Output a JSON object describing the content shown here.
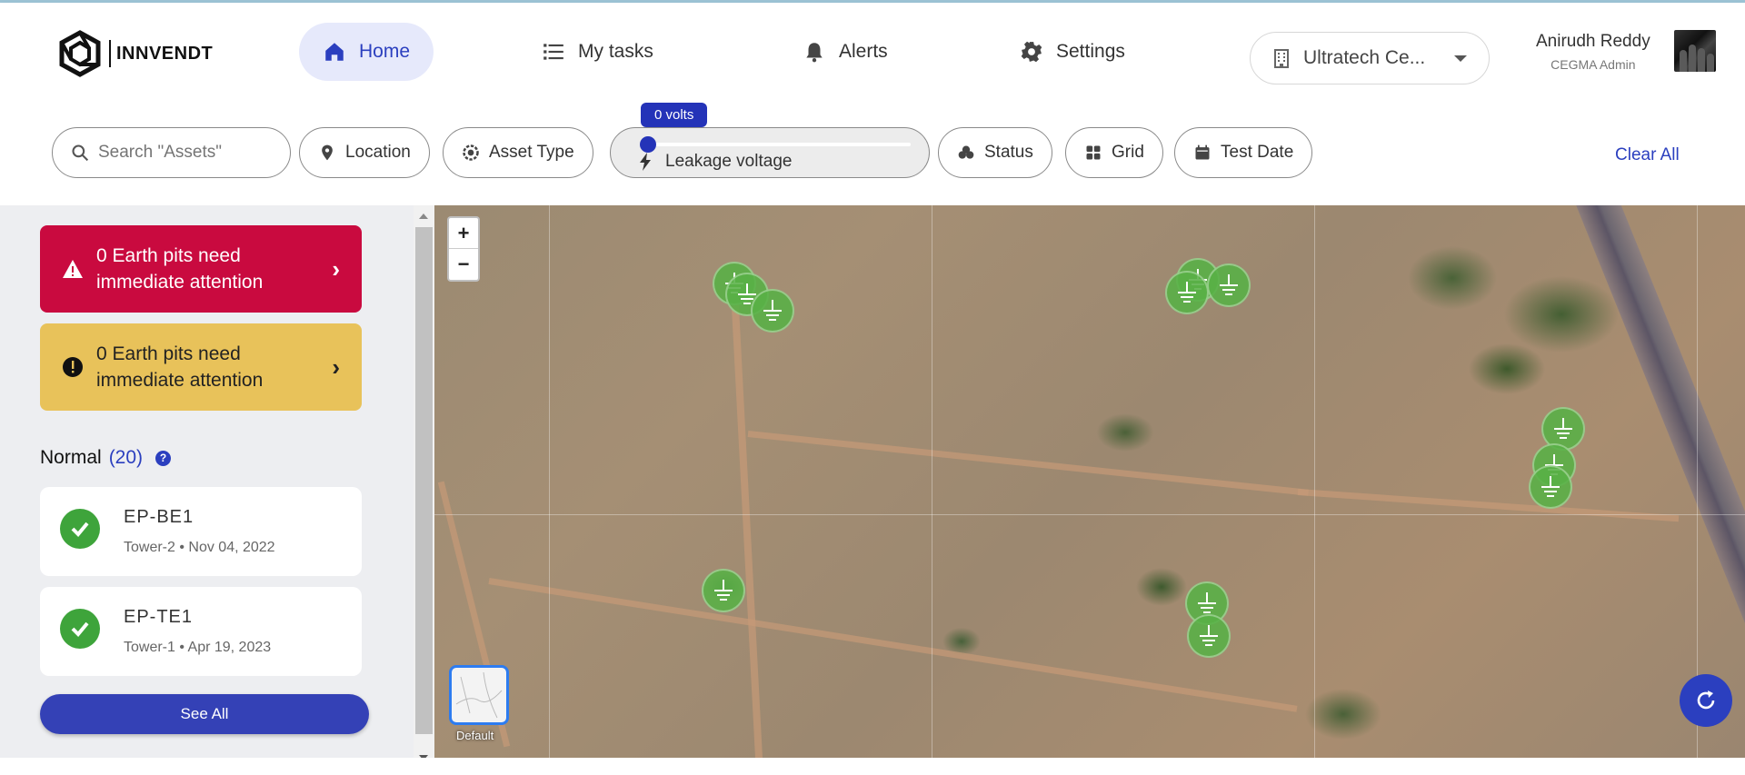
{
  "brand": {
    "name": "INNVENDT"
  },
  "nav": {
    "home": "Home",
    "tasks": "My tasks",
    "alerts": "Alerts",
    "settings": "Settings"
  },
  "org_select": {
    "value": "Ultratech Ce..."
  },
  "user": {
    "name": "Anirudh Reddy",
    "role": "CEGMA Admin"
  },
  "filters": {
    "search_placeholder": "Search \"Assets\"",
    "location": "Location",
    "asset_type": "Asset Type",
    "slider_value": "0 volts",
    "slider_label": "Leakage voltage",
    "status": "Status",
    "grid": "Grid",
    "test_date": "Test Date",
    "clear_all": "Clear All"
  },
  "sidebar": {
    "critical_alert": "0 Earth pits need immediate attention",
    "warning_alert": "0 Earth pits need immediate attention",
    "normal_label": "Normal",
    "normal_count": "(20)",
    "pits": [
      {
        "id": "EP-BE1",
        "meta": "Tower-2 • Nov 04, 2022"
      },
      {
        "id": "EP-TE1",
        "meta": "Tower-1 • Apr 19, 2023"
      }
    ],
    "see_all": "See All"
  },
  "map": {
    "zoom_in": "+",
    "zoom_out": "−",
    "layer_label": "Default",
    "marker_color": "#58b046"
  },
  "colors": {
    "accent": "#2b3fbf",
    "critical": "#c90a3f",
    "warning": "#e8c25a",
    "ok": "#3ea43b"
  }
}
